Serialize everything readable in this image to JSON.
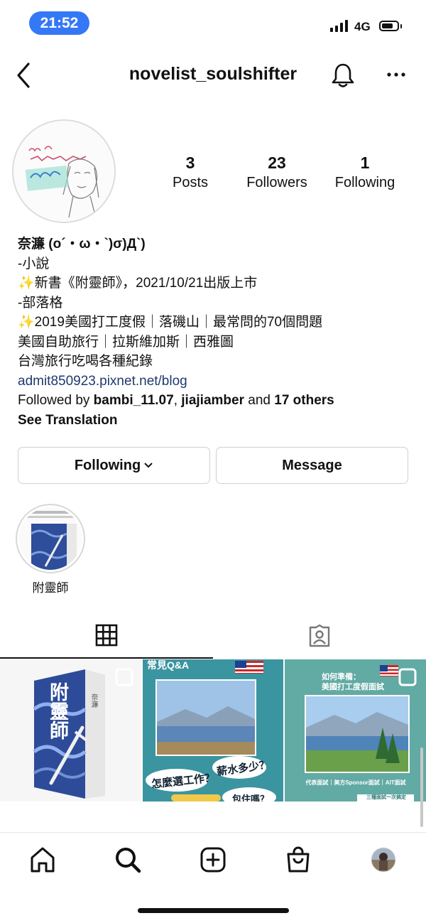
{
  "status_bar": {
    "time": "21:52",
    "network": "4G"
  },
  "header": {
    "username": "novelist_soulshifter"
  },
  "stats": [
    {
      "count": "3",
      "label": "Posts"
    },
    {
      "count": "23",
      "label": "Followers"
    },
    {
      "count": "1",
      "label": "Following"
    }
  ],
  "bio": {
    "name": "奈濂 (o´・ω・`)σ)Д`)",
    "lines": [
      "-小說",
      "新書《附靈師》，2021/10/21出版上市",
      "-部落格",
      "2019美國打工度假｜落磯山｜最常問的70個問題",
      "美國自助旅行｜拉斯維加斯｜西雅圖",
      "台灣旅行吃喝各種紀錄"
    ],
    "sparkle": "✨",
    "link": "admit850923.pixnet.net/blog",
    "followed_by_prefix": "Followed by ",
    "followed_by_user1": "bambi_11.07",
    "followed_by_sep": ", ",
    "followed_by_user2": "jiajiamber",
    "followed_by_and": " and ",
    "followed_by_others": "17 others",
    "see_translation": "See Translation"
  },
  "buttons": {
    "following": "Following",
    "message": "Message"
  },
  "highlights": [
    {
      "label": "附靈師"
    }
  ],
  "posts": [
    {
      "title": "附靈師",
      "side_text": "奈濂"
    },
    {
      "heading": "常見Q&A",
      "bubble1": "薪水多少？",
      "bubble2": "怎麼選工作？",
      "bubble3": "包住嗎？"
    },
    {
      "heading_top": "如何準備：",
      "heading": "美國打工度假面試",
      "caption": "代表面試｜美方Sponsor面試｜AIT面試",
      "banner": "三種面試一次搞定"
    }
  ],
  "colors": {
    "accent_blue": "#3478f6",
    "link": "#1e3a6e",
    "teal_bg": "#2f8e97",
    "green_bg": "#5fa8a3"
  },
  "icons": {
    "back": "chevron-left-icon",
    "bell": "bell-icon",
    "more": "more-dots-icon",
    "grid": "grid-icon",
    "tagged": "tagged-icon",
    "home": "home-icon",
    "search": "search-icon",
    "create": "plus-square-icon",
    "shop": "shopping-bag-icon",
    "profile": "avatar"
  }
}
